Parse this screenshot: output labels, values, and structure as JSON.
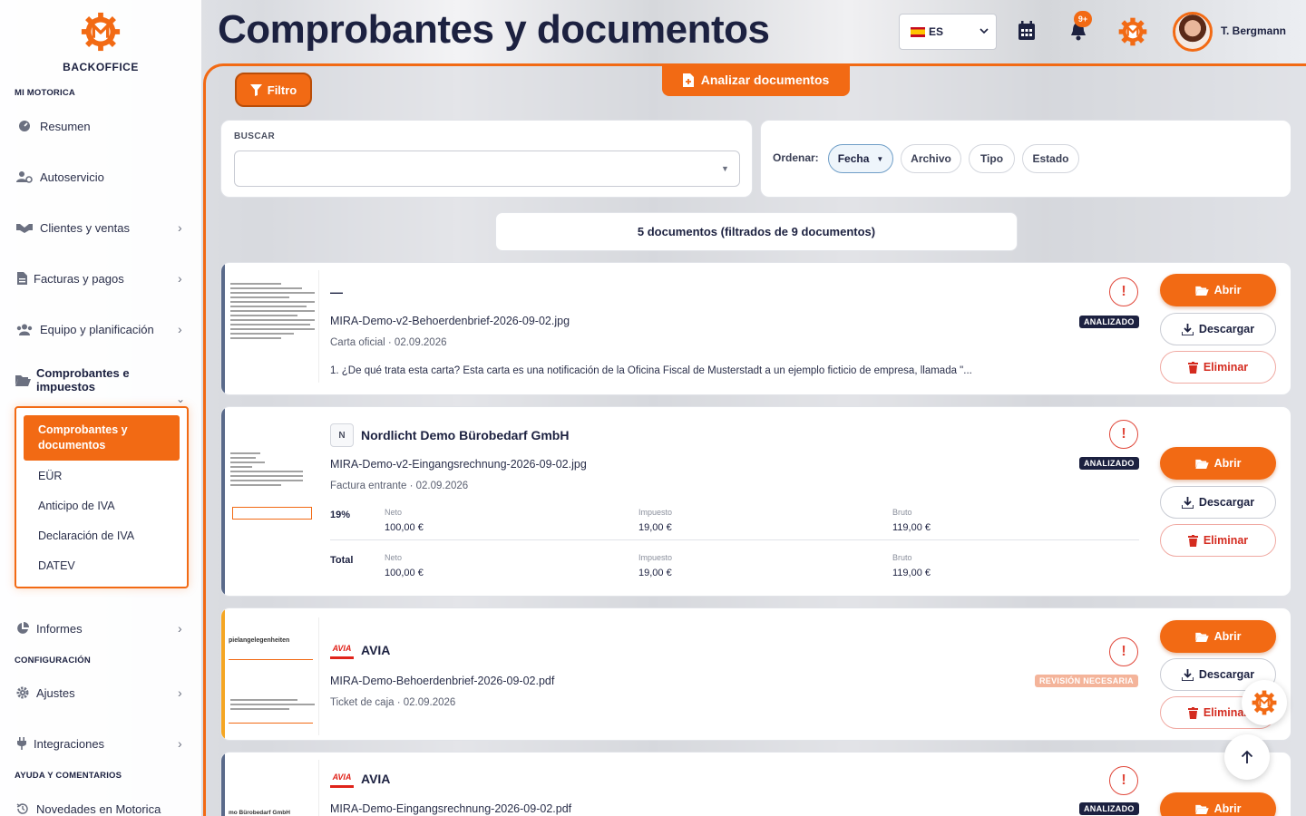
{
  "brand": {
    "name": "BACKOFFICE",
    "color": "#f26a14"
  },
  "sidebar": {
    "sections": [
      "MI MOTORICA",
      "CONFIGURACIÓN",
      "AYUDA Y COMENTARIOS"
    ],
    "items": [
      {
        "label": "Resumen",
        "icon": "dashboard-icon"
      },
      {
        "label": "Autoservicio",
        "icon": "users-cog-icon"
      },
      {
        "label": "Clientes y ventas",
        "icon": "handshake-icon"
      },
      {
        "label": "Facturas y pagos",
        "icon": "invoice-icon"
      },
      {
        "label": "Equipo y planificación",
        "icon": "team-icon"
      },
      {
        "label": "Comprobantes e impuestos",
        "icon": "folder-open-icon"
      },
      {
        "label": "Informes",
        "icon": "pie-chart-icon"
      },
      {
        "label": "Ajustes",
        "icon": "gear-icon"
      },
      {
        "label": "Integraciones",
        "icon": "plug-icon"
      },
      {
        "label": "Novedades en Motorica",
        "icon": "history-icon"
      }
    ],
    "submenu": {
      "active": "Comprobantes y documentos",
      "items": [
        "EÜR",
        "Anticipo de IVA",
        "Declaración de IVA",
        "DATEV"
      ]
    }
  },
  "header": {
    "title": "Comprobantes y documentos",
    "language": "ES",
    "notification_count": "9+",
    "user_name": "T. Bergmann"
  },
  "toolbar": {
    "filter_label": "Filtro",
    "analyze_label": "Analizar documentos"
  },
  "search": {
    "label": "BUSCAR",
    "value": "",
    "placeholder": ""
  },
  "sort": {
    "label": "Ordenar:",
    "options": [
      "Fecha",
      "Archivo",
      "Tipo",
      "Estado"
    ],
    "active": "Fecha",
    "active_indicator": "▼"
  },
  "summary": "5 documentos (filtrados de 9 documentos)",
  "actions": {
    "open": "Abrir",
    "download": "Descargar",
    "delete": "Eliminar"
  },
  "documents": [
    {
      "title": "—",
      "file": "MIRA-Demo-v2-Behoerdenbrief-2026-09-02.jpg",
      "meta": "Carta oficial · 02.09.2026",
      "description": "1. ¿De qué trata esta carta? Esta carta es una notificación de la Oficina Fiscal de Musterstadt a un ejemplo ficticio de empresa, llamada \"...",
      "status": "ANALIZADO"
    },
    {
      "title": "Nordlicht Demo Bürobedarf GmbH",
      "initial": "N",
      "file": "MIRA-Demo-v2-Eingangsrechnung-2026-09-02.jpg",
      "meta": "Factura entrante · 02.09.2026",
      "status": "ANALIZADO",
      "vat_rows": [
        {
          "rate": "19%",
          "neto_label": "Neto",
          "neto": "100,00 €",
          "impuesto_label": "Impuesto",
          "impuesto": "19,00 €",
          "bruto_label": "Bruto",
          "bruto": "119,00 €"
        },
        {
          "rate": "Total",
          "neto_label": "Neto",
          "neto": "100,00 €",
          "impuesto_label": "Impuesto",
          "impuesto": "19,00 €",
          "bruto_label": "Bruto",
          "bruto": "119,00 €"
        }
      ]
    },
    {
      "title": "AVIA",
      "logo_text": "AVIA",
      "file": "MIRA-Demo-Behoerdenbrief-2026-09-02.pdf",
      "meta": "Ticket de caja · 02.09.2026",
      "status": "REVISIÓN NECESARIA",
      "thumb_heading": "pielangelegenheiten"
    },
    {
      "title": "AVIA",
      "logo_text": "AVIA",
      "file": "MIRA-Demo-Eingangsrechnung-2026-09-02.pdf",
      "status": "ANALIZADO",
      "thumb_text": "mo Bürobedarf GmbH"
    }
  ],
  "colors": {
    "accent": "#f26a14",
    "navy": "#1c2140",
    "danger": "#d42b1f",
    "review": "#f4b49a"
  }
}
